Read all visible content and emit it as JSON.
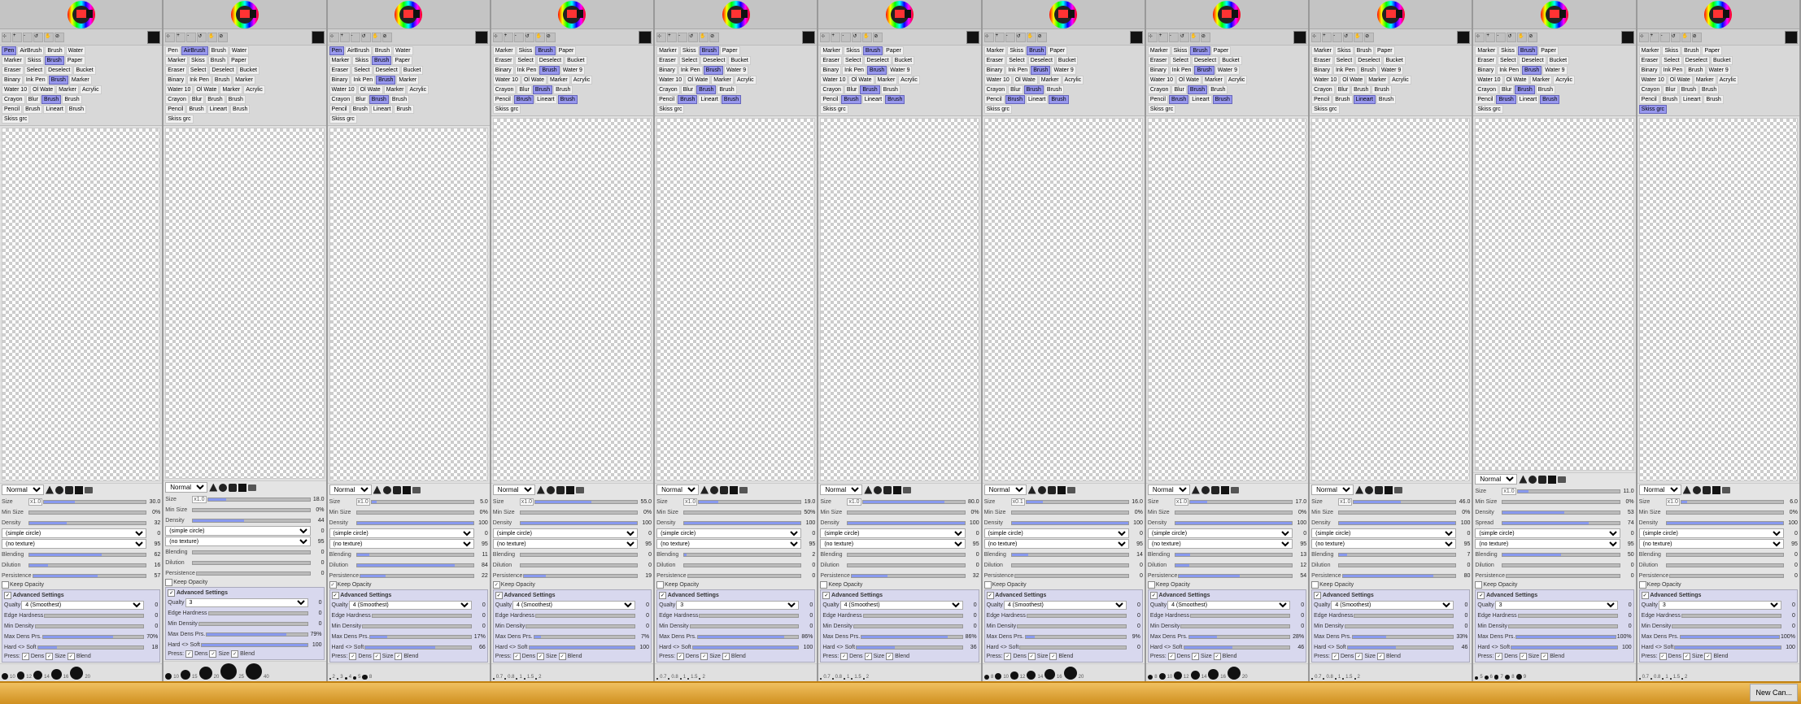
{
  "panels": [
    {
      "id": 1,
      "mode": "Normal",
      "size": 30.0,
      "sizeMultiplier": "x1.0",
      "minSize": "0%",
      "density": 32,
      "blending": 62,
      "dilution": 16,
      "persistence": 57,
      "quality": "4 (Smoothest)",
      "edgeHardness": 0,
      "minDensity": 0,
      "maxDensPrs": "70%",
      "hardSoft": 18,
      "activeBrush": "Brush",
      "activeTool": "Pen",
      "brushCircle": "(simple circle)",
      "brushTexture": "(no texture)",
      "keepOpacity": false,
      "advSettings": true,
      "press": {
        "dens": true,
        "size": true,
        "blend": true
      },
      "dotSizes": [
        10,
        12,
        14,
        16,
        20
      ]
    },
    {
      "id": 2,
      "mode": "Normal",
      "size": 18.0,
      "sizeMultiplier": "x1.0",
      "minSize": "0%",
      "density": 44,
      "blending": 0,
      "dilution": 0,
      "persistence": 0,
      "quality": "3",
      "edgeHardness": 0,
      "minDensity": 0,
      "maxDensPrs": "79%",
      "hardSoft": 100,
      "activeBrush": "Skiss",
      "activeTool": "AirBrush",
      "brushCircle": "(simple circle)",
      "brushTexture": "(no texture)",
      "keepOpacity": false,
      "advSettings": true,
      "press": {
        "dens": true,
        "size": true,
        "blend": true
      },
      "dotSizes": [
        10,
        15,
        20,
        25,
        40
      ]
    },
    {
      "id": 3,
      "mode": "Normal",
      "size": 5.0,
      "sizeMultiplier": "x1.0",
      "minSize": "0%",
      "density": 100,
      "blending": 11,
      "dilution": 84,
      "persistence": 22,
      "quality": "4 (Smoothest)",
      "edgeHardness": 0,
      "minDensity": 0,
      "maxDensPrs": "17%",
      "hardSoft": 66,
      "activeBrush": "Brush",
      "activeTool": "Pen",
      "brushCircle": "(simple circle)",
      "brushTexture": "(no texture)",
      "keepOpacity": true,
      "advSettings": true,
      "press": {
        "dens": true,
        "size": true,
        "blend": true
      },
      "dotSizes": [
        2,
        3,
        4,
        5,
        8
      ]
    },
    {
      "id": 4,
      "mode": "Normal",
      "size": 55.0,
      "sizeMultiplier": "x1.0",
      "minSize": "0%",
      "density": 100,
      "blending": 0,
      "dilution": 0,
      "persistence": 19,
      "quality": "4 (Smoothest)",
      "edgeHardness": 0,
      "minDensity": 0,
      "maxDensPrs": "7%",
      "hardSoft": 100,
      "activeBrush": "Brush",
      "activeTool": "Marker",
      "brushCircle": "(simple circle)",
      "brushTexture": "(no texture)",
      "keepOpacity": true,
      "advSettings": true,
      "press": {
        "dens": true,
        "size": true,
        "blend": true
      },
      "dotSizes": [
        0.7,
        0.8,
        1,
        1.5,
        2
      ]
    },
    {
      "id": 5,
      "mode": "Normal",
      "size": 19.0,
      "sizeMultiplier": "x1.0",
      "minSize": "50%",
      "density": 100,
      "blending": 2,
      "dilution": 0,
      "persistence": 0,
      "quality": "3",
      "edgeHardness": 0,
      "minDensity": 0,
      "maxDensPrs": "86%",
      "hardSoft": 100,
      "activeBrush": "Brush",
      "activeTool": "Ink Pen",
      "brushCircle": "(simple circle)",
      "brushTexture": "(no texture)",
      "keepOpacity": false,
      "advSettings": true,
      "press": {
        "dens": true,
        "size": true,
        "blend": true
      },
      "dotSizes": [
        0.7,
        0.8,
        1,
        1.5,
        2
      ]
    },
    {
      "id": 6,
      "mode": "Normal",
      "size": 80.0,
      "sizeMultiplier": "x1.0",
      "minSize": "0%",
      "density": 100,
      "blending": 0,
      "dilution": 0,
      "persistence": 32,
      "quality": "4 (Smoothest)",
      "edgeHardness": 0,
      "minDensity": 0,
      "maxDensPrs": "86%",
      "hardSoft": 36,
      "activeBrush": "Brush",
      "activeTool": "Ink Pen",
      "brushCircle": "(simple circle)",
      "brushTexture": "(no texture)",
      "keepOpacity": false,
      "advSettings": true,
      "press": {
        "dens": true,
        "size": true,
        "blend": true
      },
      "dotSizes": [
        0.7,
        0.8,
        1,
        1.5,
        2
      ]
    },
    {
      "id": 7,
      "mode": "Normal",
      "size": 16.0,
      "sizeMultiplier": "x0.1",
      "minSize": "0%",
      "density": 100,
      "blending": 14,
      "dilution": 0,
      "persistence": 0,
      "quality": "4 (Smoothest)",
      "edgeHardness": 0,
      "minDensity": 0,
      "maxDensPrs": "9%",
      "hardSoft": 0,
      "activeBrush": "Brush",
      "activeTool": "Ink Pen",
      "brushCircle": "(simple circle)",
      "brushTexture": "(no texture)",
      "keepOpacity": false,
      "advSettings": true,
      "press": {
        "dens": true,
        "size": true,
        "blend": true
      },
      "dotSizes": [
        8,
        10,
        12,
        14,
        16,
        20
      ]
    },
    {
      "id": 8,
      "mode": "Normal",
      "size": 17.0,
      "sizeMultiplier": "x1.0",
      "minSize": "0%",
      "density": 100,
      "blending": 13,
      "dilution": 12,
      "persistence": 54,
      "quality": "4 (Smoothest)",
      "edgeHardness": 0,
      "minDensity": 0,
      "maxDensPrs": "28%",
      "hardSoft": 46,
      "activeBrush": "Brush",
      "activeTool": "Ink Pen",
      "brushCircle": "(simple circle)",
      "brushTexture": "(no texture)",
      "keepOpacity": false,
      "advSettings": true,
      "press": {
        "dens": true,
        "size": true,
        "blend": true
      },
      "dotSizes": [
        8,
        10,
        12,
        14,
        16,
        20
      ]
    },
    {
      "id": 9,
      "mode": "Normal",
      "size": 46.0,
      "sizeMultiplier": "x1.0",
      "minSize": "0%",
      "density": 100,
      "blending": 7,
      "dilution": 0,
      "persistence": 80,
      "quality": "4 (Smoothest)",
      "edgeHardness": 0,
      "minDensity": 0,
      "maxDensPrs": "33%",
      "hardSoft": 46,
      "activeBrush": "Lineart",
      "activeTool": "Ink Pen",
      "brushCircle": "(simple circle)",
      "brushTexture": "(no texture)",
      "keepOpacity": false,
      "advSettings": true,
      "press": {
        "dens": true,
        "size": true,
        "blend": true
      },
      "dotSizes": [
        0.7,
        0.8,
        1,
        1.5,
        2
      ]
    },
    {
      "id": 10,
      "mode": "Normal",
      "size": 11.0,
      "sizeMultiplier": "x1.0",
      "minSize": "0%",
      "density": 53,
      "spread": 74,
      "blending": 50,
      "dilution": 0,
      "persistence": 0,
      "quality": "3",
      "edgeHardness": 0,
      "minDensity": 0,
      "maxDensPrs": "100%",
      "hardSoft": 100,
      "activeBrush": "Brush",
      "activeTool": "Ink Pen",
      "brushCircle": "(simple circle)",
      "brushTexture": "(no texture)",
      "keepOpacity": false,
      "advSettings": true,
      "press": {
        "dens": true,
        "size": true,
        "blend": true
      },
      "dotSizes": [
        5,
        6,
        7,
        8,
        9
      ]
    },
    {
      "id": 11,
      "mode": "Normal",
      "size": 6.0,
      "sizeMultiplier": "x1.0",
      "minSize": "0%",
      "density": 100,
      "blending": 0,
      "dilution": 0,
      "persistence": 0,
      "quality": "3",
      "edgeHardness": 0,
      "minDensity": 0,
      "maxDensPrs": "100%",
      "hardSoft": 100,
      "activeBrush": "Skiss grc",
      "activeTool": "Ink Pen",
      "brushCircle": "(simple circle)",
      "brushTexture": "(no texture)",
      "keepOpacity": false,
      "advSettings": true,
      "press": {
        "dens": true,
        "size": true,
        "blend": true
      },
      "dotSizes": [
        0.7,
        0.8,
        1,
        1.5,
        2
      ]
    }
  ],
  "taskbar": {
    "items": [],
    "newCanvas": "New Can..."
  }
}
